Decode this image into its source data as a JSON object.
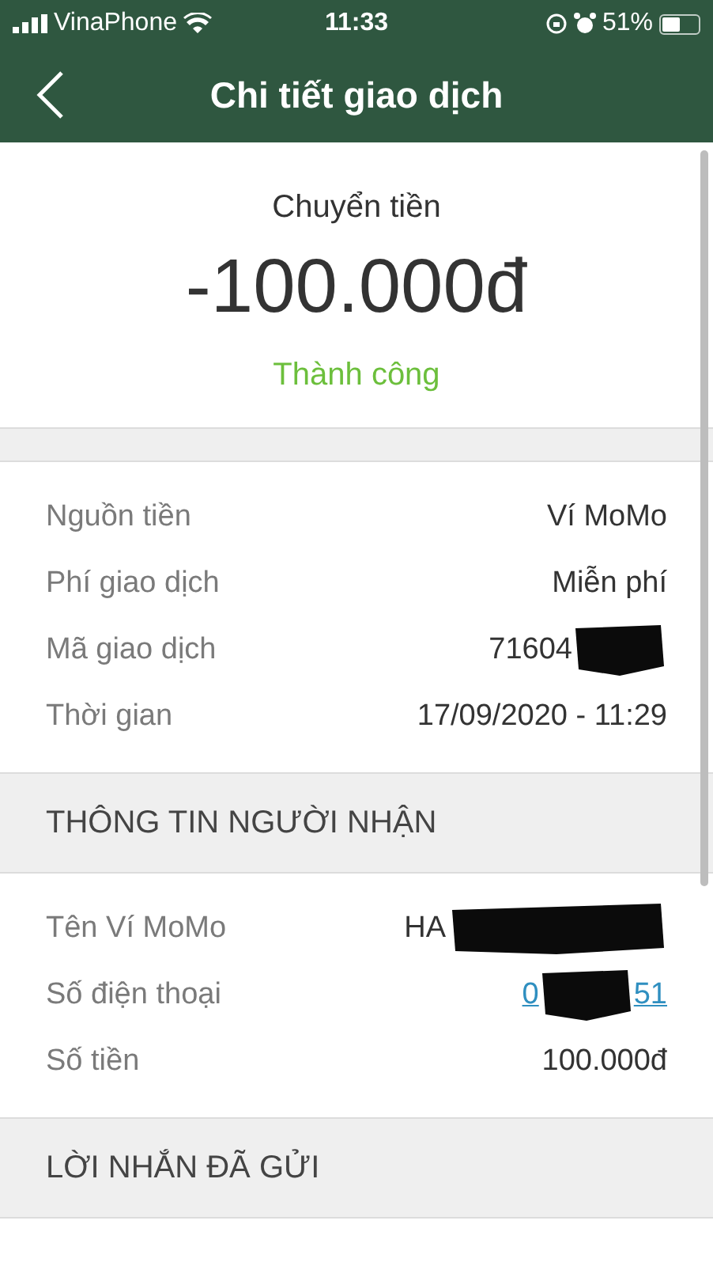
{
  "status_bar": {
    "carrier": "VinaPhone",
    "time": "11:33",
    "battery": "51%"
  },
  "header": {
    "title": "Chi tiết giao dịch"
  },
  "summary": {
    "type": "Chuyển tiền",
    "amount": "-100.000đ",
    "status": "Thành công"
  },
  "details": [
    {
      "label": "Nguồn tiền",
      "value": "Ví MoMo",
      "redacted": false
    },
    {
      "label": "Phí giao dịch",
      "value": "Miễn phí",
      "redacted": false
    },
    {
      "label": "Mã giao dịch",
      "value": "71604",
      "redacted": true
    },
    {
      "label": "Thời gian",
      "value": "17/09/2020 - 11:29",
      "redacted": false
    }
  ],
  "recipient": {
    "heading": "THÔNG TIN NGƯỜI NHẬN",
    "rows": [
      {
        "label": "Tên Ví MoMo",
        "value": "HA",
        "redacted": true,
        "kind": "text"
      },
      {
        "label": "Số điện thoại",
        "value": "0",
        "value_end": "51",
        "redacted": true,
        "kind": "link"
      },
      {
        "label": "Số tiền",
        "value": "100.000đ",
        "redacted": false,
        "kind": "text"
      }
    ]
  },
  "message": {
    "heading": "LỜI NHẮN ĐÃ GỬI"
  }
}
